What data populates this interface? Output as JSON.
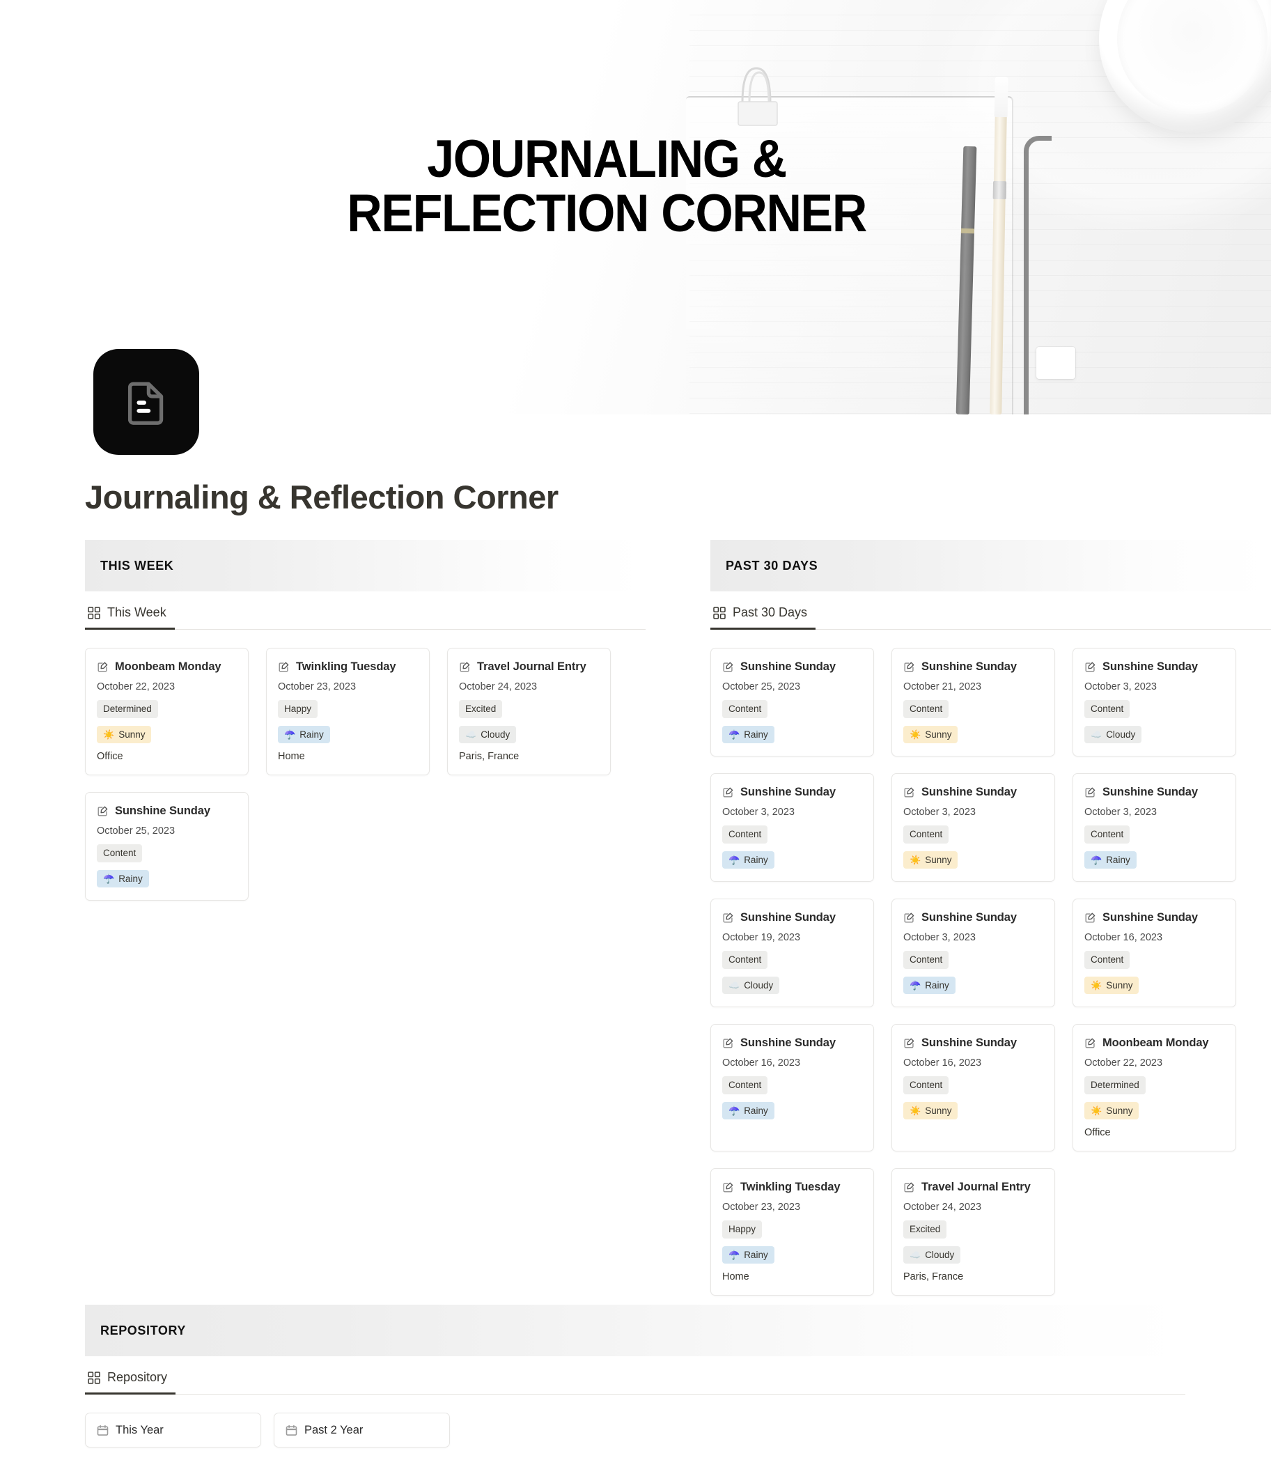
{
  "hero": {
    "banner_title": "JOURNALING &\nREFLECTION CORNER"
  },
  "page": {
    "icon": "document-icon",
    "title": "Journaling & Reflection Corner"
  },
  "sections": [
    {
      "header": "THIS WEEK",
      "tab": {
        "label": "This Week",
        "icon": "grid-icon",
        "active": true
      },
      "cards": [
        {
          "title": "Moonbeam Monday",
          "date": "October 22, 2023",
          "mood": "Determined",
          "weather": "Sunny",
          "weather_emoji": "☀️",
          "weather_class": "tag-sunny",
          "location": "Office"
        },
        {
          "title": "Twinkling Tuesday",
          "date": "October 23, 2023",
          "mood": "Happy",
          "weather": "Rainy",
          "weather_emoji": "☂️",
          "weather_class": "tag-rainy",
          "location": "Home"
        },
        {
          "title": "Travel Journal Entry",
          "date": "October 24, 2023",
          "mood": "Excited",
          "weather": "Cloudy",
          "weather_emoji": "☁️",
          "weather_class": "tag-cloudy",
          "location": "Paris, France"
        },
        {
          "title": "Sunshine Sunday",
          "date": "October 25, 2023",
          "mood": "Content",
          "weather": "Rainy",
          "weather_emoji": "☂️",
          "weather_class": "tag-rainy",
          "location": ""
        }
      ]
    },
    {
      "header": "PAST 30 DAYS",
      "tab": {
        "label": "Past 30 Days",
        "icon": "grid-icon",
        "active": true
      },
      "cards": [
        {
          "title": "Sunshine Sunday",
          "date": "October 25, 2023",
          "mood": "Content",
          "weather": "Rainy",
          "weather_emoji": "☂️",
          "weather_class": "tag-rainy",
          "location": ""
        },
        {
          "title": "Sunshine Sunday",
          "date": "October 21, 2023",
          "mood": "Content",
          "weather": "Sunny",
          "weather_emoji": "☀️",
          "weather_class": "tag-sunny",
          "location": ""
        },
        {
          "title": "Sunshine Sunday",
          "date": "October 3, 2023",
          "mood": "Content",
          "weather": "Cloudy",
          "weather_emoji": "☁️",
          "weather_class": "tag-cloudy",
          "location": ""
        },
        {
          "title": "Sunshine Sunday",
          "date": "October 3, 2023",
          "mood": "Content",
          "weather": "Rainy",
          "weather_emoji": "☂️",
          "weather_class": "tag-rainy",
          "location": ""
        },
        {
          "title": "Sunshine Sunday",
          "date": "October 3, 2023",
          "mood": "Content",
          "weather": "Sunny",
          "weather_emoji": "☀️",
          "weather_class": "tag-sunny",
          "location": ""
        },
        {
          "title": "Sunshine Sunday",
          "date": "October 3, 2023",
          "mood": "Content",
          "weather": "Rainy",
          "weather_emoji": "☂️",
          "weather_class": "tag-rainy",
          "location": ""
        },
        {
          "title": "Sunshine Sunday",
          "date": "October 19, 2023",
          "mood": "Content",
          "weather": "Cloudy",
          "weather_emoji": "☁️",
          "weather_class": "tag-cloudy",
          "location": ""
        },
        {
          "title": "Sunshine Sunday",
          "date": "October 3, 2023",
          "mood": "Content",
          "weather": "Rainy",
          "weather_emoji": "☂️",
          "weather_class": "tag-rainy",
          "location": ""
        },
        {
          "title": "Sunshine Sunday",
          "date": "October 16, 2023",
          "mood": "Content",
          "weather": "Sunny",
          "weather_emoji": "☀️",
          "weather_class": "tag-sunny",
          "location": ""
        },
        {
          "title": "Sunshine Sunday",
          "date": "October 16, 2023",
          "mood": "Content",
          "weather": "Rainy",
          "weather_emoji": "☂️",
          "weather_class": "tag-rainy",
          "location": ""
        },
        {
          "title": "Sunshine Sunday",
          "date": "October 16, 2023",
          "mood": "Content",
          "weather": "Sunny",
          "weather_emoji": "☀️",
          "weather_class": "tag-sunny",
          "location": ""
        },
        {
          "title": "Moonbeam Monday",
          "date": "October 22, 2023",
          "mood": "Determined",
          "weather": "Sunny",
          "weather_emoji": "☀️",
          "weather_class": "tag-sunny",
          "location": "Office"
        },
        {
          "title": "Twinkling Tuesday",
          "date": "October 23, 2023",
          "mood": "Happy",
          "weather": "Rainy",
          "weather_emoji": "☂️",
          "weather_class": "tag-rainy",
          "location": "Home"
        },
        {
          "title": "Travel Journal Entry",
          "date": "October 24, 2023",
          "mood": "Excited",
          "weather": "Cloudy",
          "weather_emoji": "☁️",
          "weather_class": "tag-cloudy",
          "location": "Paris, France"
        }
      ]
    }
  ],
  "repository": {
    "header": "REPOSITORY",
    "tab": {
      "label": "Repository",
      "icon": "grid-icon",
      "active": true
    },
    "cards": [
      {
        "label": "This Year",
        "icon": "calendar-icon"
      },
      {
        "label": "Past 2 Year",
        "icon": "calendar-icon"
      }
    ]
  },
  "colors": {
    "mood_tag": "#ededeb",
    "sunny_tag": "#fbedcd",
    "rainy_tag": "#d5e6f2",
    "cloudy_tag": "#ebeceb",
    "icon_bg": "#0a0a0a",
    "text": "#37352f"
  }
}
